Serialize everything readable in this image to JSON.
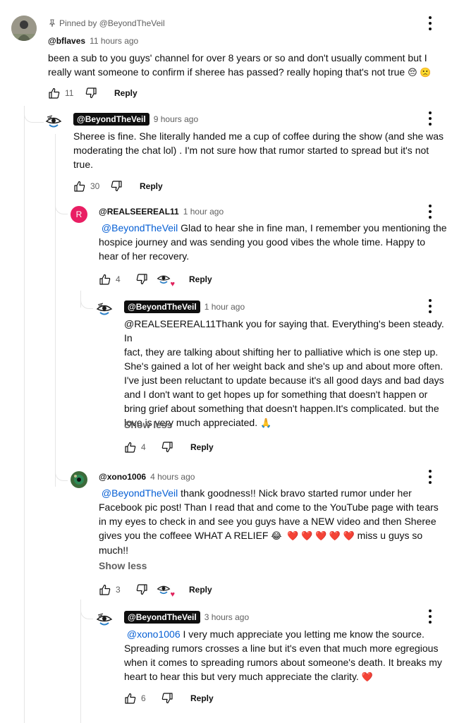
{
  "top_comment": {
    "pinned_label": "Pinned by @BeyondTheVeil",
    "author": "@bflaves",
    "time": "11 hours ago",
    "text_line1": "been a sub to you guys' channel for over 8 years or so and don't usually comment but I",
    "text_line2": "really want someone to confirm if sheree has passed? really hoping that's not true",
    "emojis": "😔 🙁",
    "likes": "11",
    "reply_label": "Reply"
  },
  "reply1": {
    "author": "@BeyondTheVeil",
    "time": "9 hours ago",
    "lines": [
      "Sheree is fine. She literally handed me a cup of coffee during the show (and she was",
      "moderating the chat lol) . I'm not sure how that rumor started to spread but it's not",
      "true."
    ],
    "likes": "30",
    "reply_label": "Reply"
  },
  "reply2": {
    "avatar_letter": "R",
    "author": "@REALSEEREAL11",
    "time": "1 hour ago",
    "mention": "@BeyondTheVeil",
    "line1_rest": "  Glad to hear she in fine man, I remember you mentioning the",
    "lines": [
      "hospice journey and was sending you good vibes the whole time. Happy to",
      "hear of her recovery."
    ],
    "likes": "4",
    "reply_label": "Reply"
  },
  "reply3": {
    "author": "@BeyondTheVeil",
    "time": "1 hour ago",
    "lines": [
      "@REALSEEREAL11Thank you for saying that. Everything's been steady. In",
      "fact, they are talking about shifting her to palliative which is one step up.",
      "She's gained a lot of her weight back and she's up and about more often.",
      "I've just been reluctant to update because it's all good days and bad days",
      "and I don't want to get hopes up for something that doesn't happen or",
      "bring grief about something that doesn't happen.It's complicated. but the",
      "love is very much appreciated."
    ],
    "pray_emoji": "🙏",
    "show_less": "Show less",
    "likes": "4",
    "reply_label": "Reply"
  },
  "reply4": {
    "author": "@xono1006",
    "time": "4 hours ago",
    "mention": "@BeyondTheVeil",
    "line1_rest": " thank goodness!! Nick bravo started rumor under her",
    "lines": [
      "Facebook pic post!   Than I read that and come to the YouTube page with tears",
      "in my eyes to check in and see you guys have a NEW video and then Sheree"
    ],
    "line4_text": "gives you the coffeee WHAT A RELIEF",
    "line4_emojis": "😂",
    "hearts": "❤️ ❤️ ❤️ ❤️ ❤️",
    "line4_tail": " miss u guys so",
    "line5": "much!!",
    "show_less": "Show less",
    "likes": "3",
    "reply_label": "Reply"
  },
  "reply5": {
    "author": "@BeyondTheVeil",
    "time": "3 hours ago",
    "mention": "@xono1006",
    "line1_rest": "  I very much appreciate you letting me know the source.",
    "lines": [
      "Spreading rumors crosses a line but it's even that much more egregious",
      "when it comes to spreading rumors about someone's death. It breaks my",
      "heart to hear this but very much appreciate the clarity."
    ],
    "heart": "❤️",
    "likes": "6",
    "reply_label": "Reply"
  },
  "colors": {
    "link": "#065fd4",
    "secondary_text": "#606060",
    "owner_badge": "#0f0f0f",
    "heart": "#e0245e"
  }
}
